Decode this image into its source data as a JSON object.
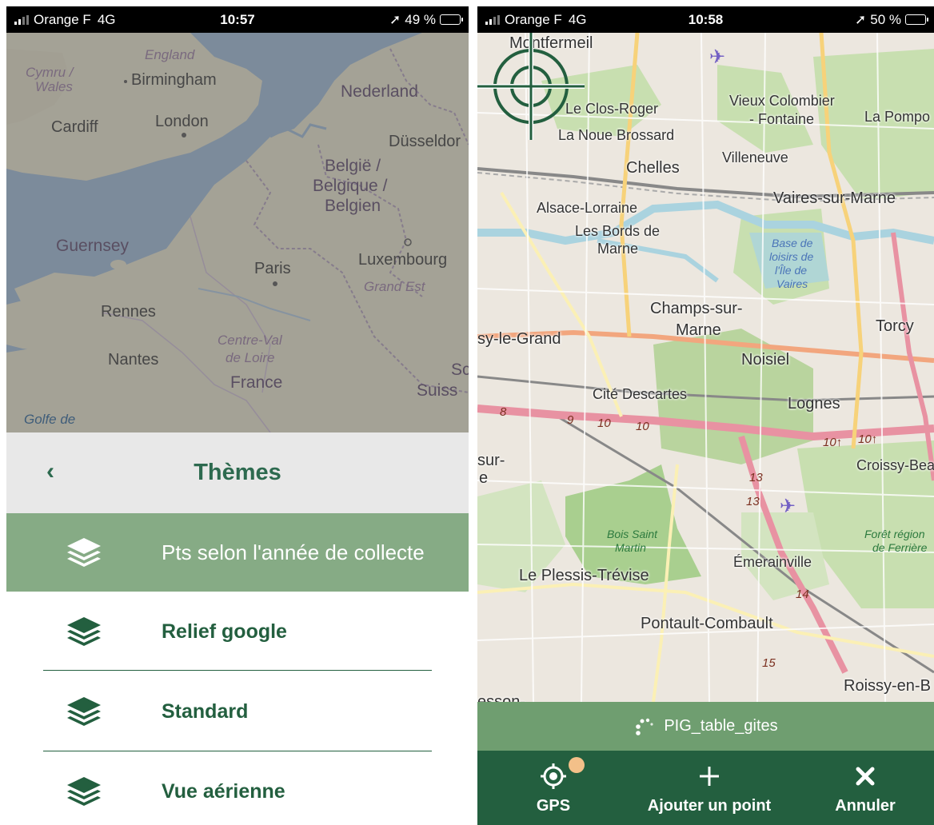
{
  "colors": {
    "accent_green": "#235f3f",
    "active_row_green": "#86ab85",
    "layer_bar_green": "#6f9e70",
    "gps_badge": "#f3c089"
  },
  "left_screen": {
    "status_bar": {
      "carrier": "Orange F",
      "network": "4G",
      "time": "10:57",
      "battery": "49 %",
      "battery_level": 0.49
    },
    "map_labels": {
      "england": "England",
      "cymru_wales_1": "Cymru /",
      "cymru_wales_2": "Wales",
      "birmingham": "Birmingham",
      "nederland": "Nederland",
      "cardiff": "Cardiff",
      "london": "London",
      "dusseldorf": "Düsseldor",
      "belgie_1": "België /",
      "belgie_2": "Belgique /",
      "belgie_3": "Belgien",
      "guernsey": "Guernsey",
      "paris": "Paris",
      "luxembourg": "Luxembourg",
      "grand_est": "Grand Est",
      "rennes": "Rennes",
      "centre_1": "Centre-Val",
      "centre_2": "de Loire",
      "nantes": "Nantes",
      "france": "France",
      "suisse_1": "Sc",
      "suisse_2": "Suiss",
      "golfe": "Golfe de"
    },
    "themes_panel": {
      "back_icon": "chevron-left-icon",
      "title": "Thèmes",
      "items": [
        {
          "label": "Pts selon l'année de collecte",
          "icon": "layers-icon",
          "selected": true
        },
        {
          "label": "Relief google",
          "icon": "layers-icon",
          "selected": false
        },
        {
          "label": "Standard",
          "icon": "layers-icon",
          "selected": false
        },
        {
          "label": "Vue aérienne",
          "icon": "layers-icon",
          "selected": false
        }
      ]
    }
  },
  "right_screen": {
    "status_bar": {
      "carrier": "Orange F",
      "network": "4G",
      "time": "10:58",
      "battery": "50 %",
      "battery_level": 0.5
    },
    "map_labels": {
      "montfermeil": "Montfermeil",
      "clos_roger": "Le Clos-Roger",
      "vieux_colombier_1": "Vieux Colombier",
      "vieux_colombier_2": "- Fontaine",
      "la_pompo": "La Pompo",
      "noue_brossard": "La Noue Brossard",
      "villeneuve": "Villeneuve",
      "chelles": "Chelles",
      "vaires": "Vaires-sur-Marne",
      "alsace_lorraine": "Alsace-Lorraine",
      "bords_marne_1": "Les Bords de",
      "bords_marne_2": "Marne",
      "base_loisirs_1": "Base de",
      "base_loisirs_2": "loisirs de",
      "base_loisirs_3": "l'Île de",
      "base_loisirs_4": "Vaires",
      "champs_1": "Champs-sur-",
      "champs_2": "Marne",
      "noisy_le_grand": "sy-le-Grand",
      "torcy": "Torcy",
      "noisiel": "Noisiel",
      "cite_descartes": "Cité Descartes",
      "lognes": "Lognes",
      "road_8": "8",
      "road_9": "9",
      "road_10a": "10",
      "road_10b": "10",
      "road_101a": "10↑",
      "road_101b": "10↑",
      "croissy_beau": "Croissy-Beau",
      "sur": "sur-",
      "e": "e",
      "road_13a": "13",
      "road_13b": "13",
      "bois_saint_martin_1": "Bois Saint",
      "bois_saint_martin_2": "Martin",
      "foret_1": "Forêt région",
      "foret_2": "de Ferrière",
      "emerainville": "Émerainville",
      "plessis_trevise": "Le Plessis-Trévise",
      "road_14": "14",
      "pontault": "Pontault-Combault",
      "road_15": "15",
      "roissy": "Roissy-en-B",
      "esson": "esson-"
    },
    "crosshair_icon": "crosshair-target-icon",
    "layer_bar": {
      "icon": "loading-spinner-icon",
      "name": "PIG_table_gites"
    },
    "bottom_bar": {
      "gps": {
        "icon": "gps-target-icon",
        "label": "GPS"
      },
      "add_point": {
        "icon": "plus-icon",
        "label": "Ajouter un point"
      },
      "cancel": {
        "icon": "close-icon",
        "label": "Annuler"
      }
    }
  }
}
